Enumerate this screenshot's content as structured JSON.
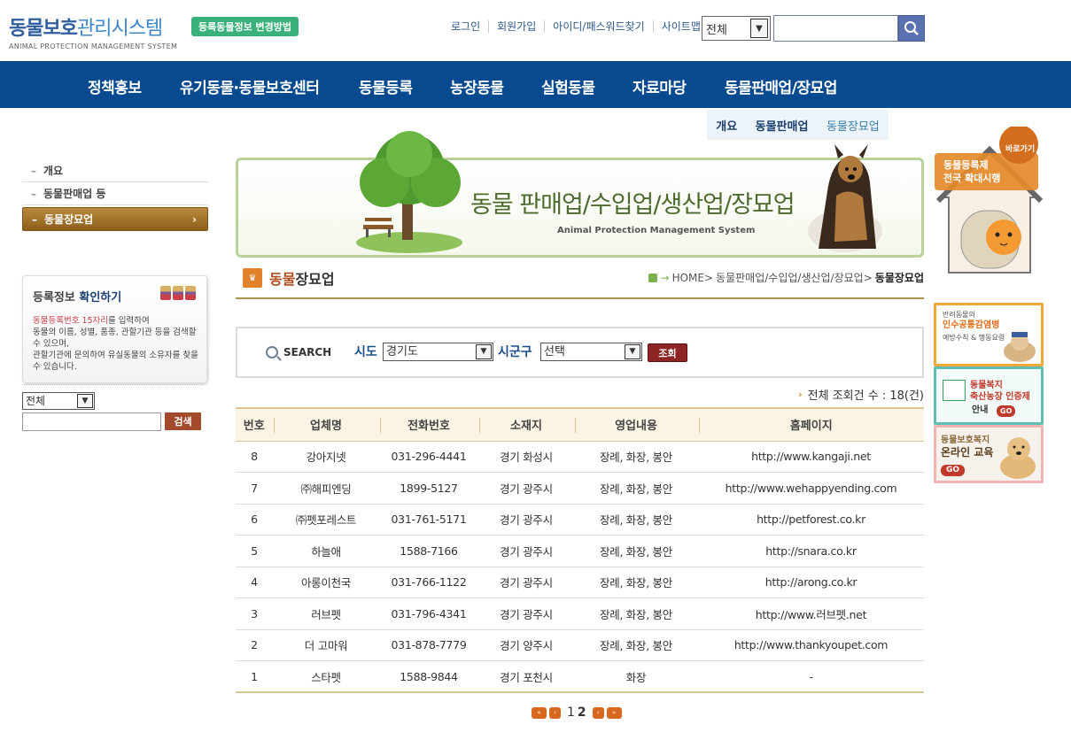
{
  "header": {
    "logo_title_a": "동물보호",
    "logo_title_b": "관리시스템",
    "logo_subtitle": "ANIMAL PROTECTION MANAGEMENT SYSTEM",
    "notice_badge": "등록동물정보 변경방법",
    "util_links": [
      "로그인",
      "회원가입",
      "아이디/패스워드찾기",
      "사이트맵"
    ],
    "search_scope": "전체",
    "search_value": ""
  },
  "gnb": [
    "정책홍보",
    "유기동물·동물보호센터",
    "동물등록",
    "농장동물",
    "실험동물",
    "자료마당",
    "동물판매업/장묘업"
  ],
  "subtabs": [
    "개요",
    "동물판매업",
    "동물장묘업"
  ],
  "lnb": {
    "items": [
      "개요",
      "동물판매업 등",
      "동물장묘업"
    ],
    "active_arrow": "›"
  },
  "reg_box": {
    "title_a": "등록정보 ",
    "title_b": "확인하기",
    "desc_hl": "동물등록번호 15자리",
    "desc_1": "를 입력하여",
    "desc_2": "동물의 이름, 성별, 품종, 관할기관 등을 검색할 수 있으며,",
    "desc_3": "관할기관에 문의하여 유실동물의 소유자를 찾을 수 있습니다.",
    "select_value": "전체",
    "search_btn": "검색"
  },
  "banner": {
    "title": "동물 판매업/수입업/생산업/장묘업",
    "subtitle": "Animal Protection Management System"
  },
  "page_title": {
    "part1": "동물",
    "part2": "장묘업"
  },
  "breadcrumb": {
    "home": "HOME",
    "sep": ">",
    "middle": "동물판매업/수입업/생산업/장묘업",
    "current": "동물장묘업"
  },
  "search": {
    "label": "SEARCH",
    "sido_label": "시도",
    "sido_value": "경기도",
    "sigungu_label": "시군구",
    "sigungu_value": "선택",
    "button": "조회"
  },
  "total": {
    "label": "전체 조회건 수 : 18(건)"
  },
  "table": {
    "headers": [
      "번호",
      "업체명",
      "전화번호",
      "소재지",
      "영업내용",
      "홈페이지"
    ],
    "rows": [
      [
        "8",
        "강아지넷",
        "031-296-4441",
        "경기 화성시",
        "장례, 화장, 봉안",
        "http://www.kangaji.net"
      ],
      [
        "7",
        "㈜해피엔딩",
        "1899-5127",
        "경기 광주시",
        "장례, 화장, 봉안",
        "http://www.wehappyending.com"
      ],
      [
        "6",
        "㈜펫포레스트",
        "031-761-5171",
        "경기 광주시",
        "장례, 화장, 봉안",
        "http://petforest.co.kr"
      ],
      [
        "5",
        "하늘애",
        "1588-7166",
        "경기 광주시",
        "장례, 화장, 봉안",
        "http://snara.co.kr"
      ],
      [
        "4",
        "아롱이천국",
        "031-766-1122",
        "경기 광주시",
        "장례, 화장, 봉안",
        "http://arong.co.kr"
      ],
      [
        "3",
        "러브펫",
        "031-796-4341",
        "경기 광주시",
        "장례, 화장, 봉안",
        "http://www.러브펫.net"
      ],
      [
        "2",
        "더 고마워",
        "031-878-7779",
        "경기 양주시",
        "장례, 화장, 봉안",
        "http://www.thankyoupet.com"
      ],
      [
        "1",
        "스타펫",
        "1588-9844",
        "경기 포천시",
        "화장",
        "-"
      ]
    ]
  },
  "pager": {
    "pages": [
      "1",
      "2"
    ],
    "current": "2"
  },
  "quick": {
    "go_badge": "바로가기",
    "line1": "동물등록제",
    "line2": "전국 확대시행",
    "b1_small": "반려동물의",
    "b1_main": "인수공통감염병",
    "b1_sub": "예방수칙 & 행동요령",
    "b2_main": "동물복지",
    "b2_main2": "축산농장 인증제",
    "b2_sub": "안내",
    "b2_go": "GO",
    "b3_main": "동물보호복지",
    "b3_main2": "온라인 교육",
    "b3_go": "GO"
  },
  "colors": {
    "gnb_bg": "#084a8f",
    "brand_green": "#3ab17a",
    "accent_brown": "#8c5f1c",
    "search_btn": "#8e2525"
  }
}
